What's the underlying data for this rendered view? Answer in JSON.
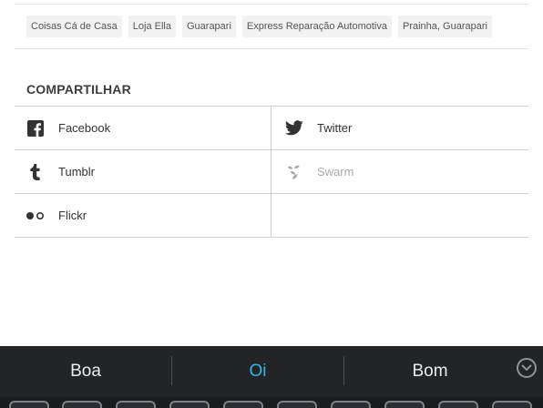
{
  "tags": [
    "Coisas Cá de Casa",
    "Loja Ella",
    "Guarapari",
    "Express Reparação Automotiva",
    "Prainha, Guarapari"
  ],
  "share": {
    "heading": "COMPARTILHAR",
    "items": [
      {
        "label": "Facebook",
        "icon": "facebook-icon",
        "enabled": true
      },
      {
        "label": "Twitter",
        "icon": "twitter-icon",
        "enabled": true
      },
      {
        "label": "Tumblr",
        "icon": "tumblr-icon",
        "enabled": true
      },
      {
        "label": "Swarm",
        "icon": "swarm-icon",
        "enabled": false
      },
      {
        "label": "Flickr",
        "icon": "flickr-icon",
        "enabled": true
      }
    ]
  },
  "keyboard": {
    "suggestions": [
      "Boa",
      "Oi",
      "Bom"
    ],
    "active_suggestion": "Oi",
    "expand_icon": "chevron-down-circle-icon",
    "colors": {
      "bar": "#222426",
      "active": "#33b5e5",
      "text": "#ececec"
    }
  }
}
